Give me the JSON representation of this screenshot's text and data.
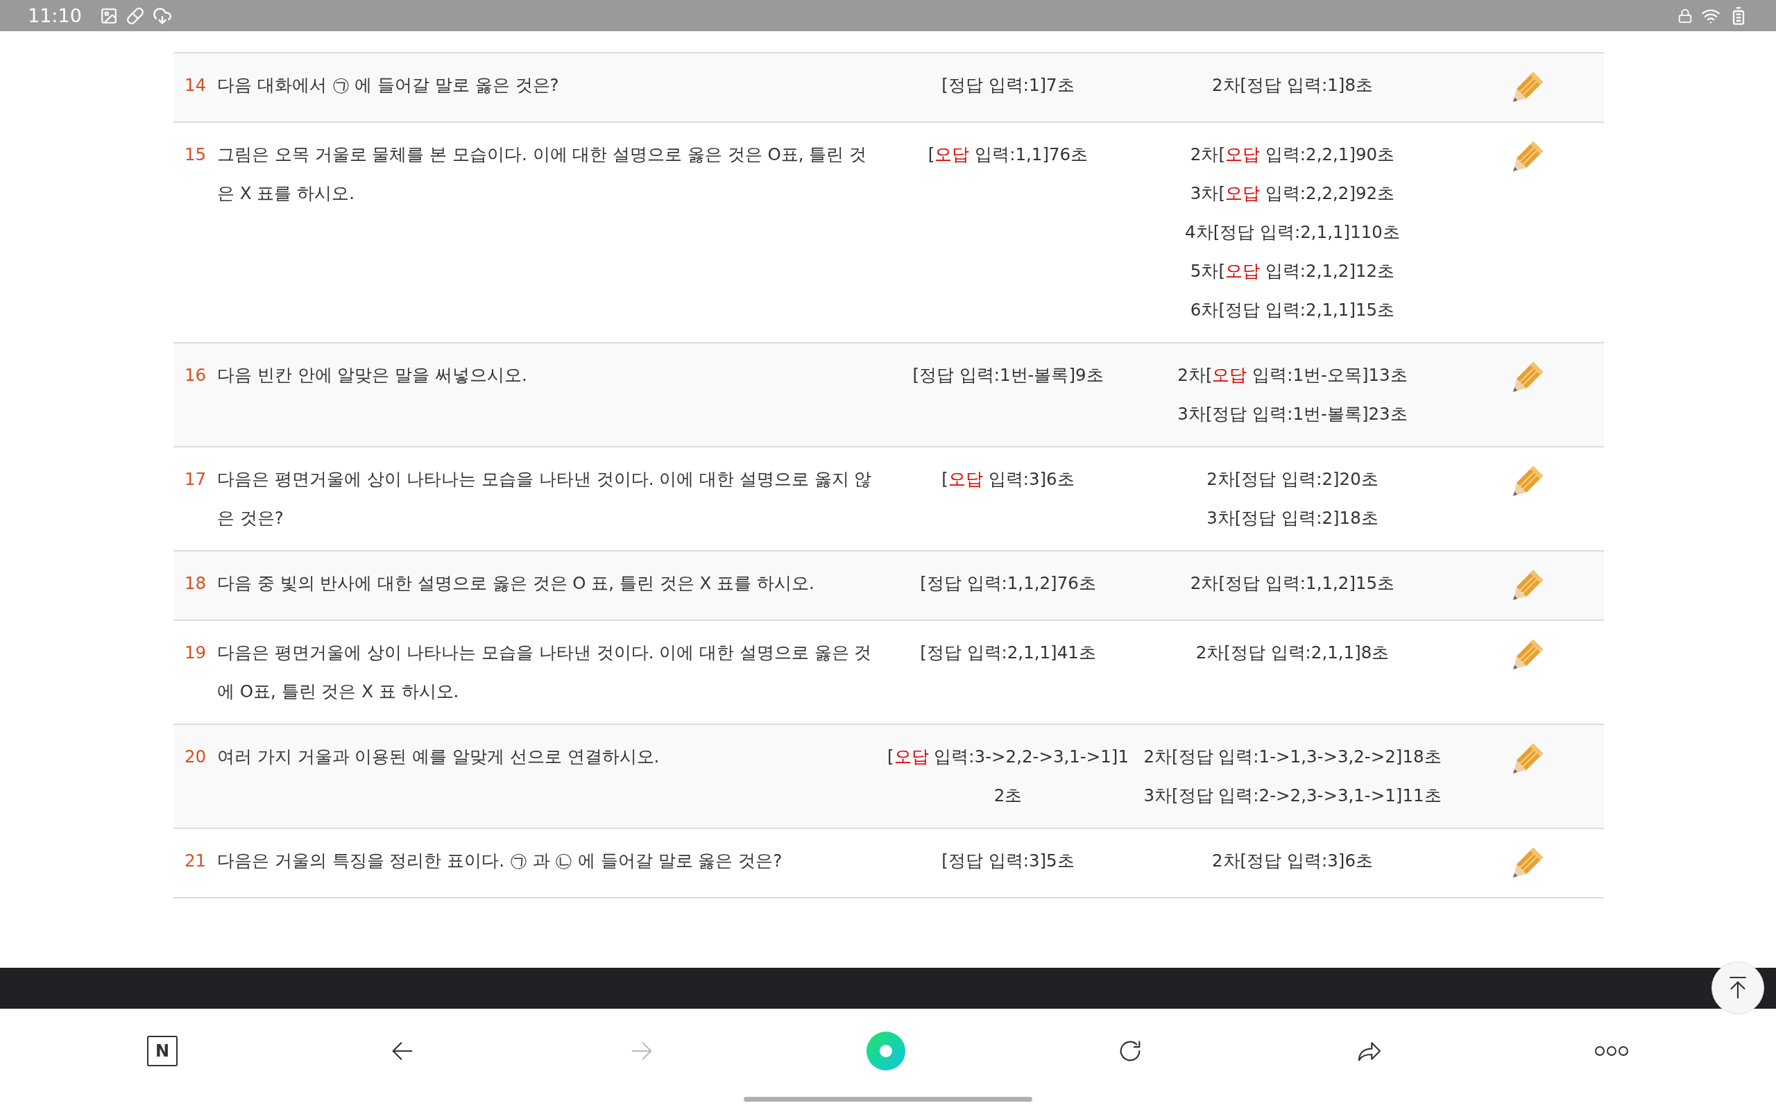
{
  "status_bar": {
    "time": "11:10"
  },
  "rows": [
    {
      "number": "14",
      "question": "다음 대화에서 ㉠ 에 들어갈 말로 옳은 것은?",
      "first": {
        "correct": true,
        "before": "[",
        "verdict": "정답",
        "after": " 입력:1]7초"
      },
      "retries": [
        {
          "correct": true,
          "before": "2차[",
          "verdict": "정답",
          "after": " 입력:1]8초"
        }
      ]
    },
    {
      "number": "15",
      "question": "그림은 오목 거울로 물체를 본 모습이다. 이에 대한 설명으로 옳은 것은 O표, 틀린 것은 X 표를 하시오.",
      "first": {
        "correct": false,
        "before": "[",
        "verdict": "오답",
        "after": " 입력:1,1]76초"
      },
      "retries": [
        {
          "correct": false,
          "before": "2차[",
          "verdict": "오답",
          "after": " 입력:2,2,1]90초"
        },
        {
          "correct": false,
          "before": "3차[",
          "verdict": "오답",
          "after": " 입력:2,2,2]92초"
        },
        {
          "correct": true,
          "before": "4차[",
          "verdict": "정답",
          "after": " 입력:2,1,1]110초"
        },
        {
          "correct": false,
          "before": "5차[",
          "verdict": "오답",
          "after": " 입력:2,1,2]12초"
        },
        {
          "correct": true,
          "before": "6차[",
          "verdict": "정답",
          "after": " 입력:2,1,1]15초"
        }
      ]
    },
    {
      "number": "16",
      "question": "다음  빈칸 안에 알맞은  말을  써넣으시오.",
      "first": {
        "correct": true,
        "before": "[",
        "verdict": "정답",
        "after": " 입력:1번-볼록]9초"
      },
      "retries": [
        {
          "correct": false,
          "before": "2차[",
          "verdict": "오답",
          "after": " 입력:1번-오목]13초"
        },
        {
          "correct": true,
          "before": "3차[",
          "verdict": "정답",
          "after": " 입력:1번-볼록]23초"
        }
      ]
    },
    {
      "number": "17",
      "question": "다음은  평면거울에  상이  나타나는  모습을  나타낸  것이다.  이에  대한  설명으로  옳지  않은  것은?",
      "first": {
        "correct": false,
        "before": "[",
        "verdict": "오답",
        "after": " 입력:3]6초"
      },
      "retries": [
        {
          "correct": true,
          "before": "2차[",
          "verdict": "정답",
          "after": " 입력:2]20초"
        },
        {
          "correct": true,
          "before": "3차[",
          "verdict": "정답",
          "after": " 입력:2]18초"
        }
      ]
    },
    {
      "number": "18",
      "question": "다음 중 빛의 반사에 대한 설명으로 옳은 것은 O 표, 틀린 것은 X 표를 하시오.",
      "first": {
        "correct": true,
        "before": "[",
        "verdict": "정답",
        "after": " 입력:1,1,2]76초"
      },
      "retries": [
        {
          "correct": true,
          "before": "2차[",
          "verdict": "정답",
          "after": " 입력:1,1,2]15초"
        }
      ]
    },
    {
      "number": "19",
      "question": "다음은 평면거울에 상이 나타나는 모습을 나타낸 것이다. 이에 대한 설명으로 옳은 것에 O표, 틀린 것은 X 표 하시오.",
      "first": {
        "correct": true,
        "before": "[",
        "verdict": "정답",
        "after": " 입력:2,1,1]41초"
      },
      "retries": [
        {
          "correct": true,
          "before": "2차[",
          "verdict": "정답",
          "after": " 입력:2,1,1]8초"
        }
      ]
    },
    {
      "number": "20",
      "question": "여러  가지  거울과  이용된  예를  알맞게  선으로  연결하시오.",
      "first": {
        "correct": false,
        "before": "[",
        "verdict": "오답",
        "after": " 입력:3->2,2->3,1->1]12초"
      },
      "retries": [
        {
          "correct": true,
          "before": "2차[",
          "verdict": "정답",
          "after": " 입력:1->1,3->3,2->2]18초"
        },
        {
          "correct": true,
          "before": "3차[",
          "verdict": "정답",
          "after": " 입력:2->2,3->3,1->1]11초"
        }
      ]
    },
    {
      "number": "21",
      "question": "다음은 거울의 특징을 정리한 표이다. ㉠ 과 ㉡ 에 들어갈 말로 옳은 것은?",
      "first": {
        "correct": true,
        "before": "[",
        "verdict": "정답",
        "after": " 입력:3]5초"
      },
      "retries": [
        {
          "correct": true,
          "before": "2차[",
          "verdict": "정답",
          "after": " 입력:3]6초"
        }
      ]
    }
  ],
  "nav_bar": {
    "logo_letter": "N",
    "forward_disabled": true
  }
}
